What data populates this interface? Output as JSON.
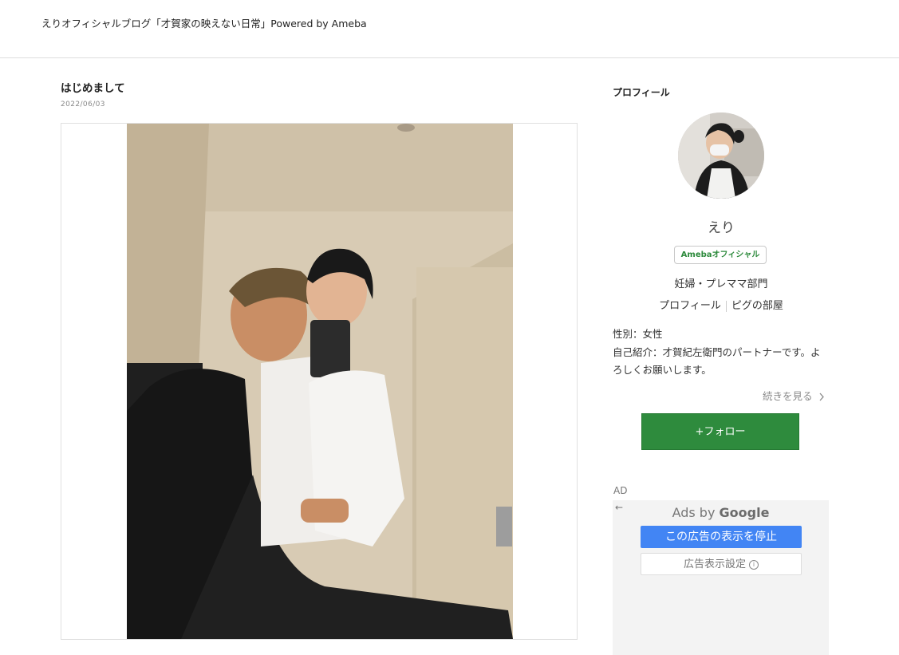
{
  "header": {
    "title": "えりオフィシャルブログ「才賀家の映えない日常」Powered by Ameba"
  },
  "article": {
    "title": "はじめまして",
    "date": "2022/06/03"
  },
  "sidebar": {
    "heading": "プロフィール",
    "name": "えり",
    "badge": "Amebaオフィシャル",
    "genre": "妊婦・プレママ部門",
    "links": [
      "プロフィール",
      "ピグの部屋"
    ],
    "gender": "性別：女性",
    "intro": "自己紹介：才賀紀左衛門のパートナーです。よろしくお願いします。",
    "read_more": "続きを見る",
    "follow": "+フォロー"
  },
  "ad": {
    "label": "AD",
    "ads_by": "Ads by",
    "google": "Google",
    "stop": "この広告の表示を停止",
    "settings": "広告表示設定",
    "back_icon": "←"
  },
  "colors": {
    "follow_green": "#2e8b3d",
    "ad_blue": "#4285f4"
  }
}
